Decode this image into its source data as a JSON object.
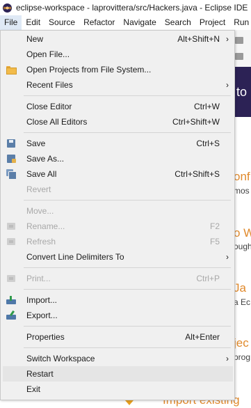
{
  "window": {
    "title": "eclipse-workspace - laprovittera/src/Hackers.java - Eclipse IDE"
  },
  "menubar": {
    "items": [
      "File",
      "Edit",
      "Source",
      "Refactor",
      "Navigate",
      "Search",
      "Project",
      "Run"
    ]
  },
  "file_menu": {
    "new": {
      "label": "New",
      "accel": "Alt+Shift+N"
    },
    "open_file": {
      "label": "Open File..."
    },
    "open_projects": {
      "label": "Open Projects from File System...",
      "icon": "folder-icon"
    },
    "recent_files": {
      "label": "Recent Files"
    },
    "close_editor": {
      "label": "Close Editor",
      "accel": "Ctrl+W"
    },
    "close_all_editors": {
      "label": "Close All Editors",
      "accel": "Ctrl+Shift+W"
    },
    "save": {
      "label": "Save",
      "accel": "Ctrl+S",
      "icon": "save-icon"
    },
    "save_as": {
      "label": "Save As...",
      "icon": "save-as-icon"
    },
    "save_all": {
      "label": "Save All",
      "accel": "Ctrl+Shift+S",
      "icon": "save-all-icon"
    },
    "revert": {
      "label": "Revert",
      "enabled": false
    },
    "move": {
      "label": "Move...",
      "enabled": false
    },
    "rename": {
      "label": "Rename...",
      "accel": "F2",
      "enabled": false,
      "icon": "rename-icon"
    },
    "refresh": {
      "label": "Refresh",
      "accel": "F5",
      "enabled": false,
      "icon": "refresh-icon"
    },
    "convert_line_delimiters": {
      "label": "Convert Line Delimiters To"
    },
    "print": {
      "label": "Print...",
      "accel": "Ctrl+P",
      "enabled": false,
      "icon": "print-icon"
    },
    "import": {
      "label": "Import...",
      "icon": "import-icon"
    },
    "export": {
      "label": "Export...",
      "icon": "export-icon"
    },
    "properties": {
      "label": "Properties",
      "accel": "Alt+Enter"
    },
    "switch_workspace": {
      "label": "Switch Workspace"
    },
    "restart": {
      "label": "Restart",
      "hovered": true
    },
    "exit": {
      "label": "Exit"
    }
  },
  "background": {
    "header_fragment": "to",
    "fragments": [
      "onf",
      "mos",
      "o W",
      "ough",
      "Ja",
      "a Ec",
      "jec",
      "prog"
    ],
    "bottom_text": "Import existing"
  },
  "colors": {
    "menu_bg": "#f0f0f0",
    "menubar_active": "#dfe9f5",
    "hover": "#e5e5e5",
    "disabled_text": "#a8a8a8",
    "header_bg": "#2c2255",
    "accent_orange": "#e0892b"
  }
}
